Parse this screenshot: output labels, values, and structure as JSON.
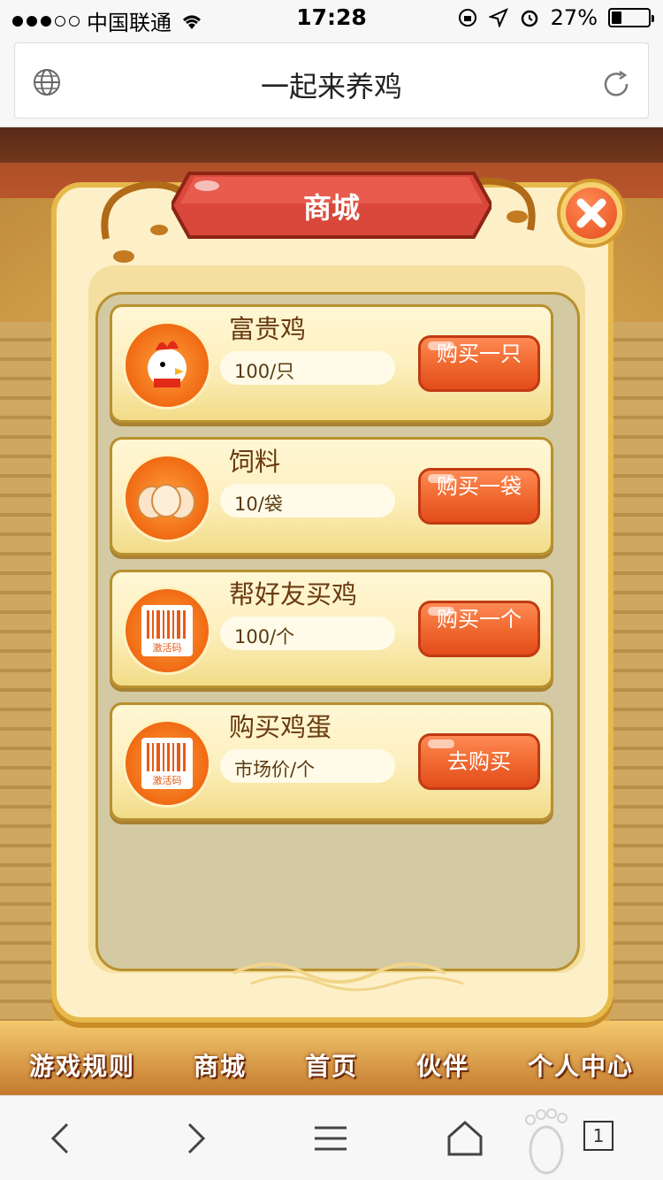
{
  "status_bar": {
    "carrier": "中国联通",
    "time": "17:28",
    "battery": "27%",
    "battery_level": 0.27
  },
  "browser": {
    "page_title": "一起来养鸡",
    "tab_count": "1"
  },
  "game_nav": [
    "游戏规则",
    "商城",
    "首页",
    "伙伴",
    "个人中心"
  ],
  "modal": {
    "title": "商城",
    "items": [
      {
        "name": "富贵鸡",
        "price": "100/只",
        "button": "购买一只",
        "icon": "rooster-icon"
      },
      {
        "name": "饲料",
        "price": "10/袋",
        "button": "购买一袋",
        "icon": "eggs-icon"
      },
      {
        "name": "帮好友买鸡",
        "price": "100/个",
        "button": "购买一个",
        "icon": "barcode-icon",
        "icon_text": "激活码"
      },
      {
        "name": "购买鸡蛋",
        "price": "市场价/个",
        "button": "去购买",
        "icon": "barcode-icon",
        "icon_text": "激活码"
      }
    ]
  }
}
